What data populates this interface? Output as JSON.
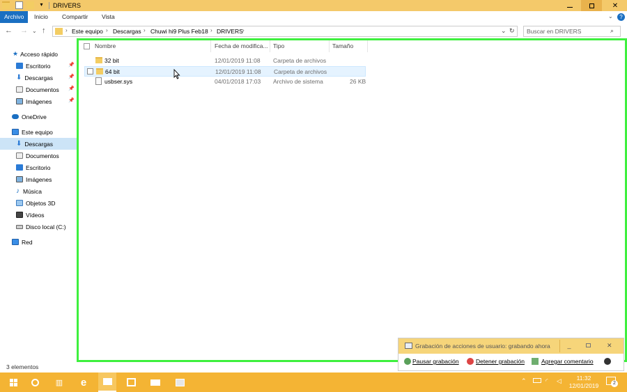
{
  "window": {
    "title": "DRIVERS"
  },
  "ribbon": {
    "tabs": [
      "Archivo",
      "Inicio",
      "Compartir",
      "Vista"
    ]
  },
  "address": {
    "crumbs": [
      "Este equipo",
      "Descargas",
      "Chuwi hi9 Plus Feb18",
      "DRIVERS"
    ],
    "search_placeholder": "Buscar en DRIVERS"
  },
  "sidebar": {
    "quick_access": "Acceso rápido",
    "quick_items": [
      "Escritorio",
      "Descargas",
      "Documentos",
      "Imágenes"
    ],
    "onedrive": "OneDrive",
    "this_pc": "Este equipo",
    "pc_items": [
      "Descargas",
      "Documentos",
      "Escritorio",
      "Imágenes",
      "Música",
      "Objetos 3D",
      "Vídeos",
      "Disco local (C:)"
    ],
    "network": "Red"
  },
  "columns": {
    "name": "Nombre",
    "date": "Fecha de modifica...",
    "type": "Tipo",
    "size": "Tamaño"
  },
  "files": [
    {
      "name": "32 bit",
      "date": "12/01/2019 11:08",
      "type": "Carpeta de archivos",
      "size": ""
    },
    {
      "name": "64 bit",
      "date": "12/01/2019 11:08",
      "type": "Carpeta de archivos",
      "size": ""
    },
    {
      "name": "usbser.sys",
      "date": "04/01/2018 17:03",
      "type": "Archivo de sistema",
      "size": "26 KB"
    }
  ],
  "status": {
    "count": "3 elementos"
  },
  "psr": {
    "title": "Grabación de acciones de usuario: grabando ahora",
    "pause": "Pausar grabación",
    "stop": "Detener grabación",
    "comment": "Agregar comentario"
  },
  "taskbar": {
    "time": "11:32",
    "date": "12/01/2019",
    "notif_count": "2"
  },
  "colors": {
    "accent": "#1a6fc2",
    "titlebar": "#f4c96a",
    "taskbar": "#f4b434",
    "highlight_frame": "#3ef03e"
  }
}
